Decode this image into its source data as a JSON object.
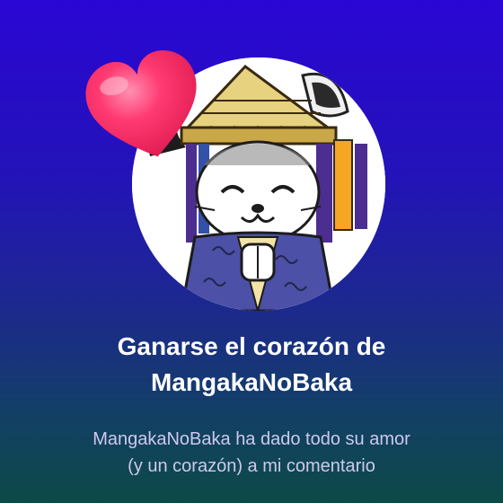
{
  "achievement": {
    "title_lines": [
      "Ganarse el corazón de",
      "MangakaNoBaka"
    ],
    "description_lines": [
      "MangakaNoBaka ha dado todo su amor",
      "(y un corazón) a mi comentario"
    ]
  },
  "icons": {
    "avatar": "manga-cat-with-straw-hat-avatar",
    "badge": "heart-icon"
  },
  "colors": {
    "background_top": "#2a06d4",
    "background_bottom": "#0e4a47",
    "heart": "#ff2e6b",
    "title": "#ffffff",
    "description": "#cfc8ee"
  }
}
